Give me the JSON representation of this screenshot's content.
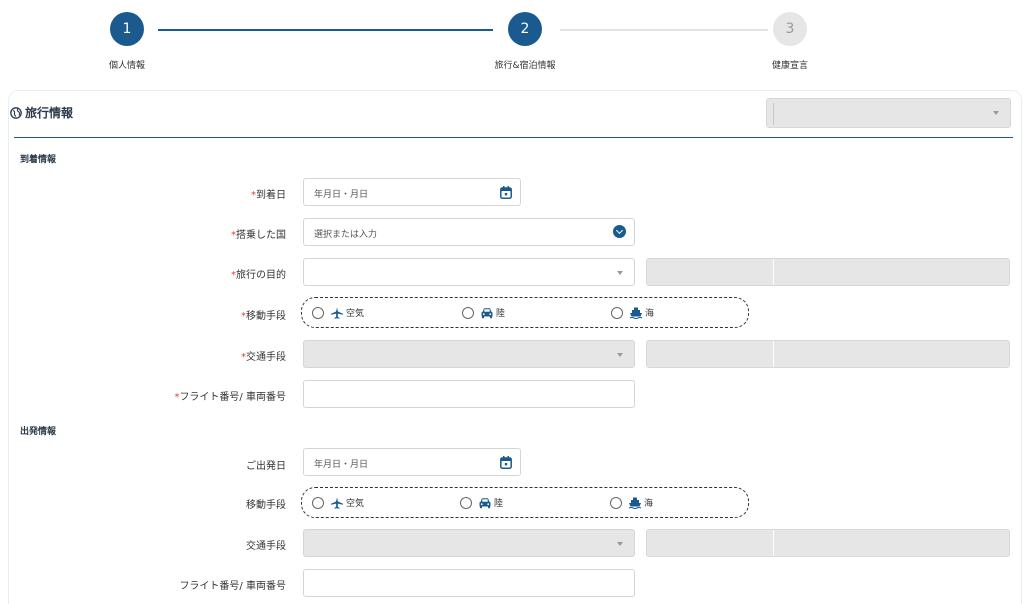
{
  "stepper": {
    "steps": [
      {
        "number": "1",
        "label": "個人情報",
        "state": "done"
      },
      {
        "number": "2",
        "label": "旅行&宿泊情報",
        "state": "active"
      },
      {
        "number": "3",
        "label": "健康宣言",
        "state": "todo"
      }
    ]
  },
  "section": {
    "title": "旅行情報",
    "icon": "globe-icon"
  },
  "arrival": {
    "group_title": "到着情報",
    "arrival_date": {
      "label": "到着日",
      "required": "*",
      "placeholder": "年月日・月日"
    },
    "boarding_country": {
      "label": "搭乗した国",
      "required": "*",
      "placeholder": "選択または入力"
    },
    "purpose": {
      "label": "旅行の目的",
      "required": "*"
    },
    "transport_mode": {
      "label": "移動手段",
      "required": "*",
      "options": [
        "空気",
        "陸",
        "海"
      ]
    },
    "transport_type": {
      "label": "交通手段",
      "required": "*"
    },
    "flight_number": {
      "label": "フライト番号/ 車両番号",
      "required": "*"
    }
  },
  "departure": {
    "group_title": "出発情報",
    "departure_date": {
      "label": "ご出発日",
      "placeholder": "年月日・月日"
    },
    "transport_mode": {
      "label": "移動手段",
      "options": [
        "空気",
        "陸",
        "海"
      ]
    },
    "transport_type": {
      "label": "交通手段"
    },
    "flight_number": {
      "label": "フライト番号/ 車両番号"
    }
  },
  "colors": {
    "primary": "#1a5a8f",
    "required": "#e0403f",
    "disabled": "#e6e6e6"
  }
}
